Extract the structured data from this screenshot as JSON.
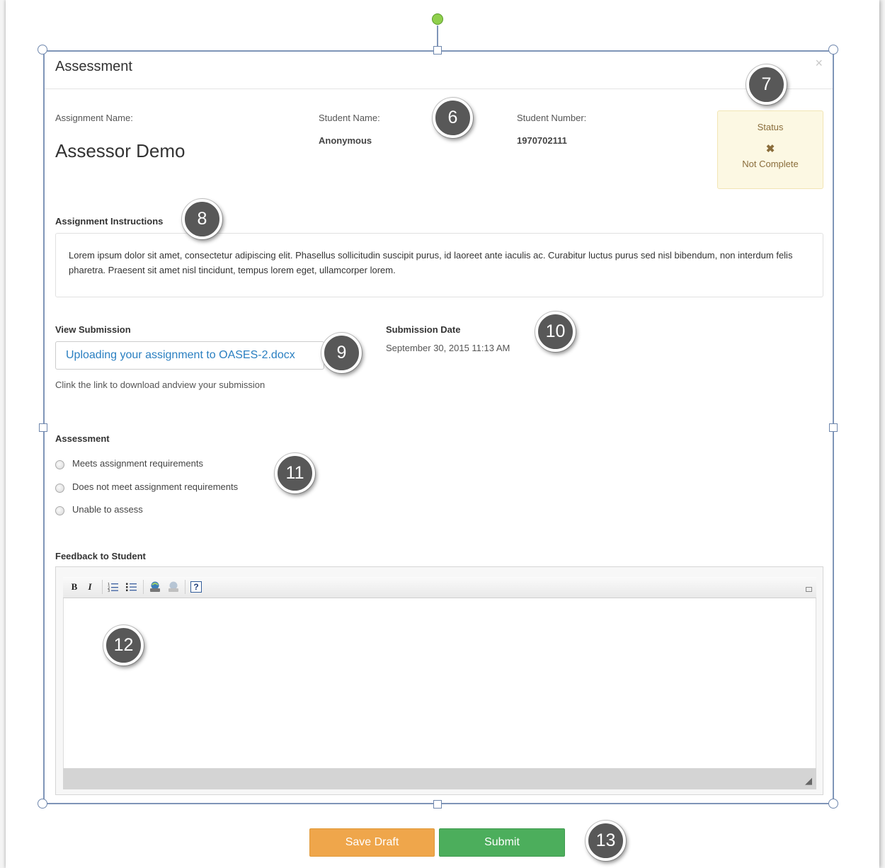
{
  "modal": {
    "title": "Assessment",
    "close": "×"
  },
  "info": {
    "assignment_label": "Assignment Name:",
    "assignment_value": "Assessor Demo",
    "student_name_label": "Student Name:",
    "student_name_value": "Anonymous",
    "student_number_label": "Student Number:",
    "student_number_value": "1970702111"
  },
  "status": {
    "title": "Status",
    "icon": "✖",
    "value": "Not Complete",
    "colors": {
      "background": "#fcf8e3",
      "text": "#8a6d3b"
    }
  },
  "instructions": {
    "label": "Assignment Instructions",
    "text": "Lorem ipsum dolor sit amet, consectetur adipiscing elit. Phasellus sollicitudin suscipit purus, id laoreet ante iaculis ac. Curabitur luctus purus sed nisl bibendum, non interdum felis pharetra. Praesent sit amet nisl tincidunt, tempus lorem eget, ullamcorper lorem."
  },
  "submission": {
    "label": "View Submission",
    "link_text": "Uploading your assignment to OASES-2.docx",
    "help": "Clink the link to download andview your submission",
    "date_label": "Submission Date",
    "date_value": "September 30, 2015 11:13 AM"
  },
  "assessment": {
    "label": "Assessment",
    "options": [
      "Meets assignment requirements",
      "Does not meet assignment requirements",
      "Unable to assess"
    ]
  },
  "feedback": {
    "label": "Feedback to Student",
    "toolbar": {
      "bold": "B",
      "italic": "I",
      "ordered_list": "⋮≡",
      "unordered_list": "⋮≡",
      "help": "?"
    }
  },
  "actions": {
    "save_draft": "Save Draft",
    "submit": "Submit",
    "colors": {
      "save_draft": "#efa64b",
      "submit": "#4cae5c"
    }
  },
  "callouts": [
    "6",
    "7",
    "8",
    "9",
    "10",
    "11",
    "12",
    "13"
  ]
}
